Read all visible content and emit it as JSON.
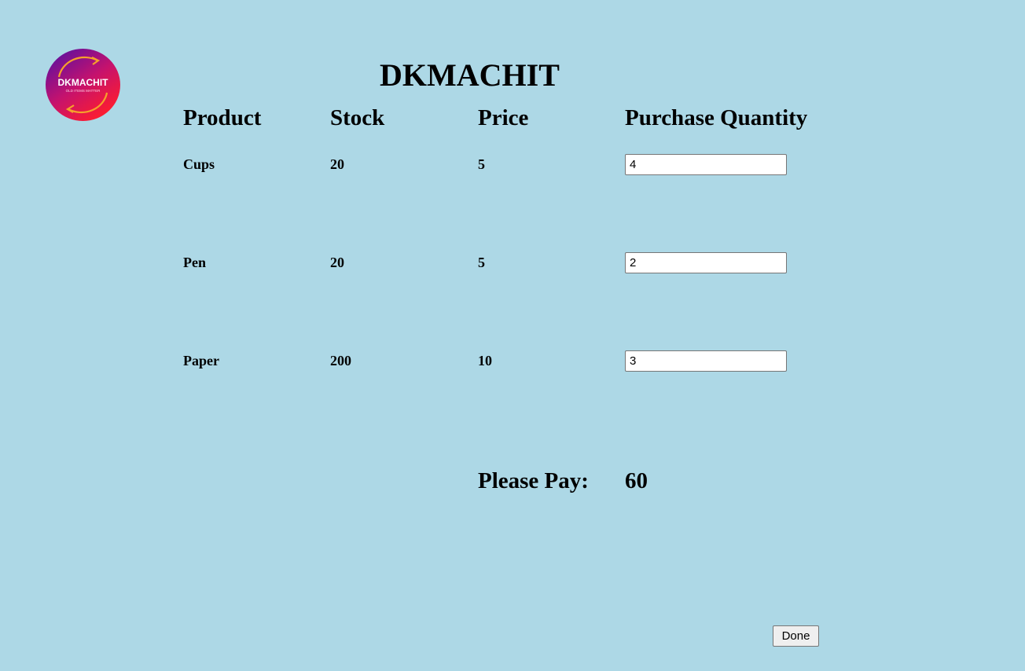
{
  "header": {
    "title": "DKMACHIT",
    "logo": {
      "brand": "DKMACHIT",
      "tagline": "OLD ITEMS MATTER",
      "gradient_colors": [
        "#4b0fa8",
        "#c4126e",
        "#ff1d2d"
      ],
      "arrow_color": "#f5a12b"
    }
  },
  "table": {
    "columns": [
      "Product",
      "Stock",
      "Price",
      "Purchase Quantity"
    ],
    "rows": [
      {
        "product": "Cups",
        "stock": "20",
        "price": "5",
        "quantity": "4"
      },
      {
        "product": "Pen",
        "stock": "20",
        "price": "5",
        "quantity": "2"
      },
      {
        "product": "Paper",
        "stock": "200",
        "price": "10",
        "quantity": "3"
      }
    ]
  },
  "summary": {
    "pay_label": "Please Pay:",
    "pay_value": "60"
  },
  "actions": {
    "done_label": "Done"
  },
  "colors": {
    "background": "#add8e6"
  }
}
